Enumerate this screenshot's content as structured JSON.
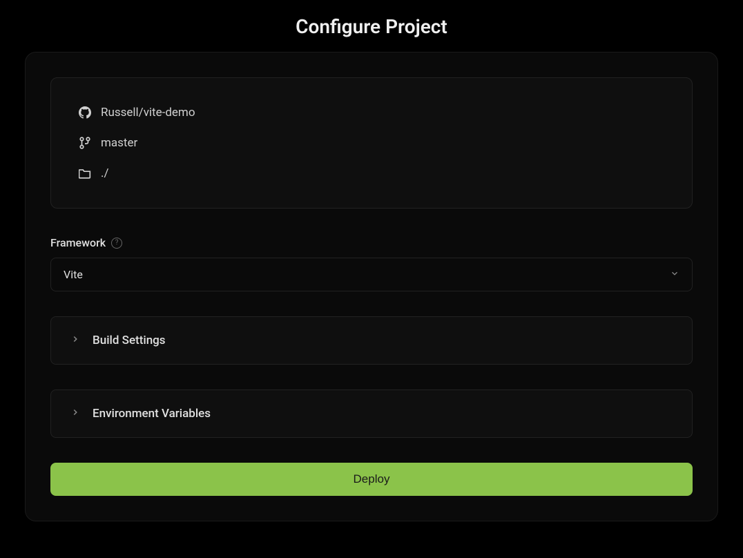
{
  "header": {
    "title": "Configure Project"
  },
  "repo": {
    "name": "Russell/vite-demo",
    "branch": "master",
    "directory": "./"
  },
  "framework": {
    "label": "Framework",
    "selected": "Vite"
  },
  "sections": {
    "build_settings": "Build Settings",
    "env_vars": "Environment Variables"
  },
  "actions": {
    "deploy": "Deploy"
  },
  "colors": {
    "accent": "#8bc34a"
  }
}
